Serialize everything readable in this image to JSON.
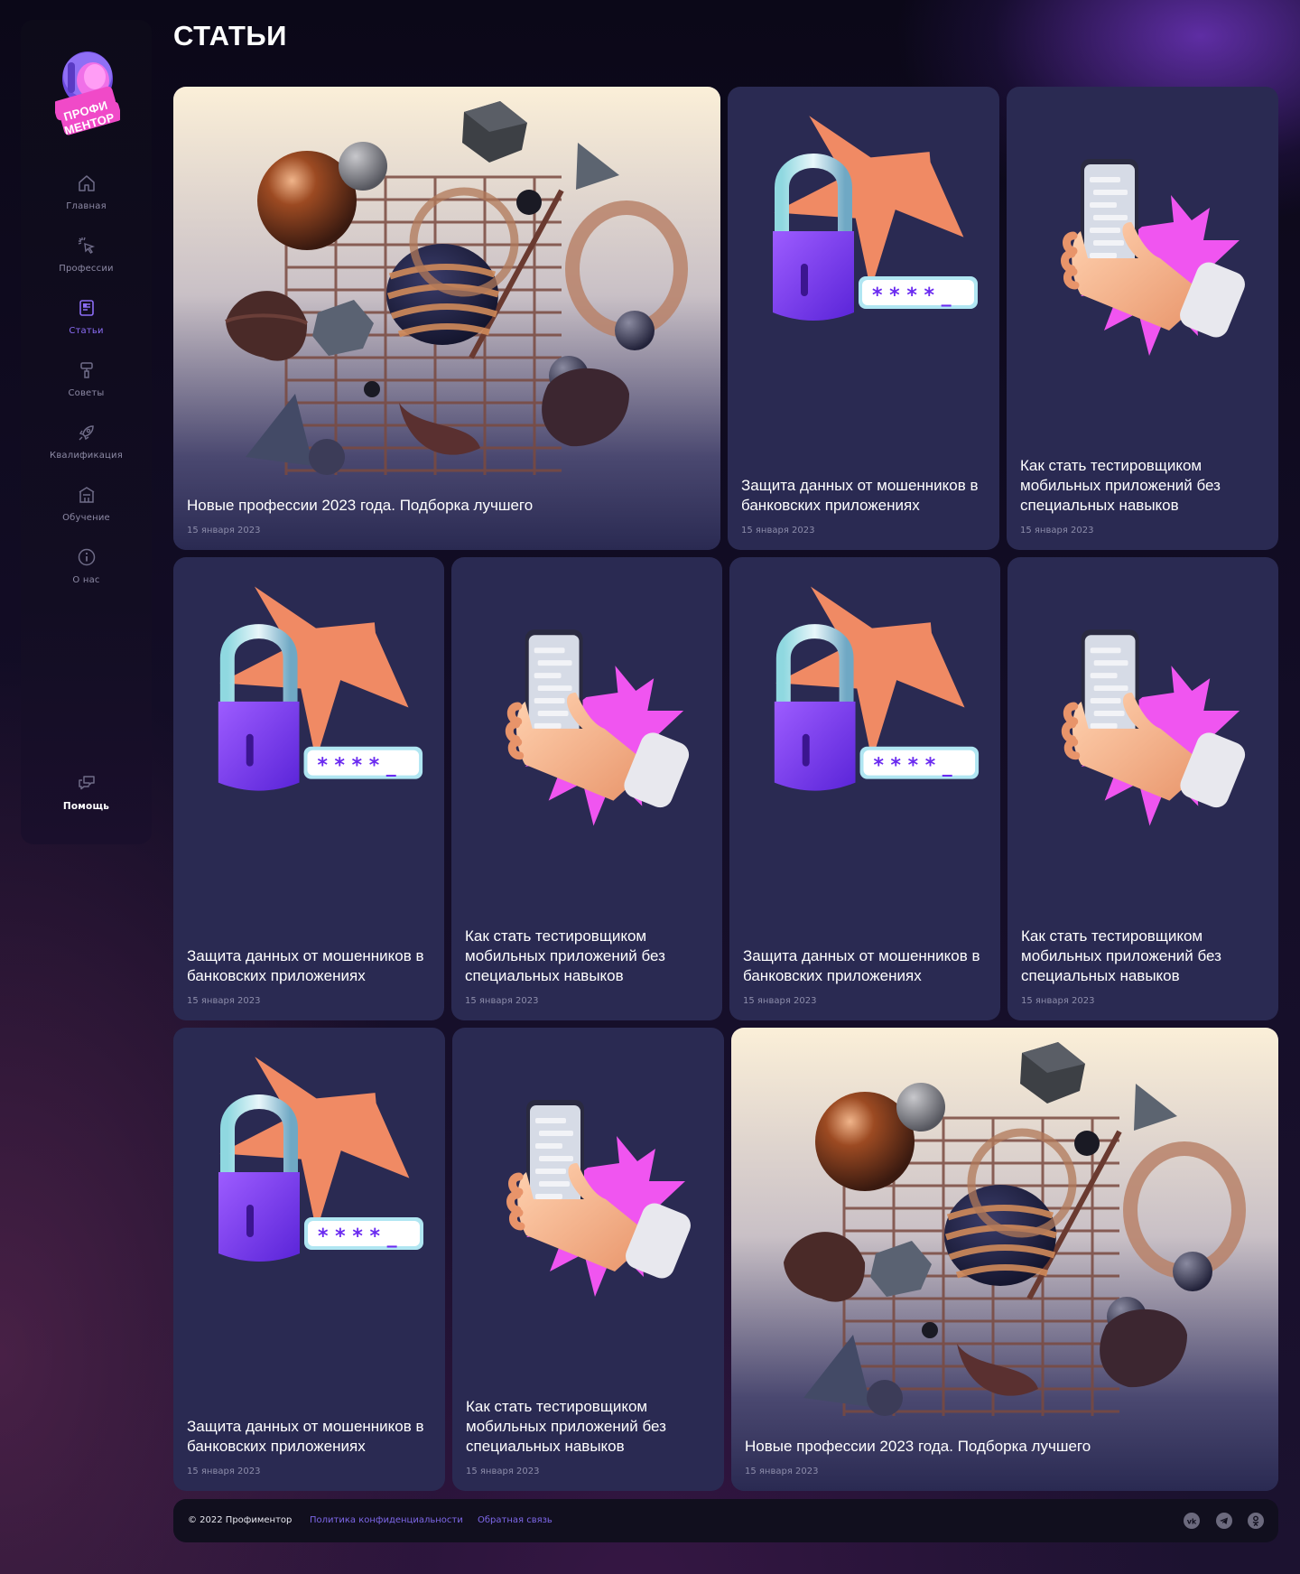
{
  "app": {
    "logo_text": "ПРОФИ МЕНТОР"
  },
  "sidebar": {
    "items": [
      {
        "label": "Главная",
        "icon": "home-icon",
        "active": false
      },
      {
        "label": "Профессии",
        "icon": "cursor-click-icon",
        "active": false
      },
      {
        "label": "Статьи",
        "icon": "article-icon",
        "active": true
      },
      {
        "label": "Советы",
        "icon": "brush-icon",
        "active": false
      },
      {
        "label": "Квалификация",
        "icon": "rocket-icon",
        "active": false
      },
      {
        "label": "Обучение",
        "icon": "building-icon",
        "active": false
      },
      {
        "label": "О нас",
        "icon": "info-icon",
        "active": false
      }
    ],
    "help": {
      "label": "Помощь",
      "icon": "chat-icon"
    }
  },
  "page": {
    "title": "СТАТЬИ"
  },
  "articles": [
    {
      "title": "Новые профессии 2023 года. Подборка лучшего",
      "date": "15 января 2023",
      "image": "abstract-3d-shapes-grid"
    },
    {
      "title": "Защита данных от мошенников в банковских приложениях",
      "date": "15 января 2023",
      "image": "padlock-password-icon"
    },
    {
      "title": "Как стать тестировщиком мобильных приложений без специальных навыков",
      "date": "15 января 2023",
      "image": "hand-phone-icon"
    },
    {
      "title": "Защита данных от мошенников в банковских приложениях",
      "date": "15 января 2023",
      "image": "padlock-password-icon"
    },
    {
      "title": "Как стать тестировщиком мобильных приложений без специальных навыков",
      "date": "15 января 2023",
      "image": "hand-phone-icon"
    },
    {
      "title": "Защита данных от мошенников в банковских приложениях",
      "date": "15 января 2023",
      "image": "padlock-password-icon"
    },
    {
      "title": "Как стать тестировщиком мобильных приложений без специальных навыков",
      "date": "15 января 2023",
      "image": "hand-phone-icon"
    },
    {
      "title": "Защита данных от мошенников в банковских приложениях",
      "date": "15 января 2023",
      "image": "padlock-password-icon"
    },
    {
      "title": "Как стать тестировщиком мобильных приложений без специальных навыков",
      "date": "15 января 2023",
      "image": "hand-phone-icon"
    },
    {
      "title": "Новые профессии 2023 года. Подборка лучшего",
      "date": "15 января 2023",
      "image": "abstract-3d-shapes-grid"
    }
  ],
  "footer": {
    "copyright": "© 2022 Профиментор",
    "privacy": "Политика конфиденциальности",
    "feedback": "Обратная связь",
    "socials": [
      "vk-icon",
      "telegram-icon",
      "odnoklassniki-icon"
    ]
  },
  "colors": {
    "accent": "#8b6df5",
    "card": "#2a2a52",
    "star_orange": "#f08a64",
    "burst_pink": "#f055f0",
    "lock_purple": "#7b3df0"
  }
}
